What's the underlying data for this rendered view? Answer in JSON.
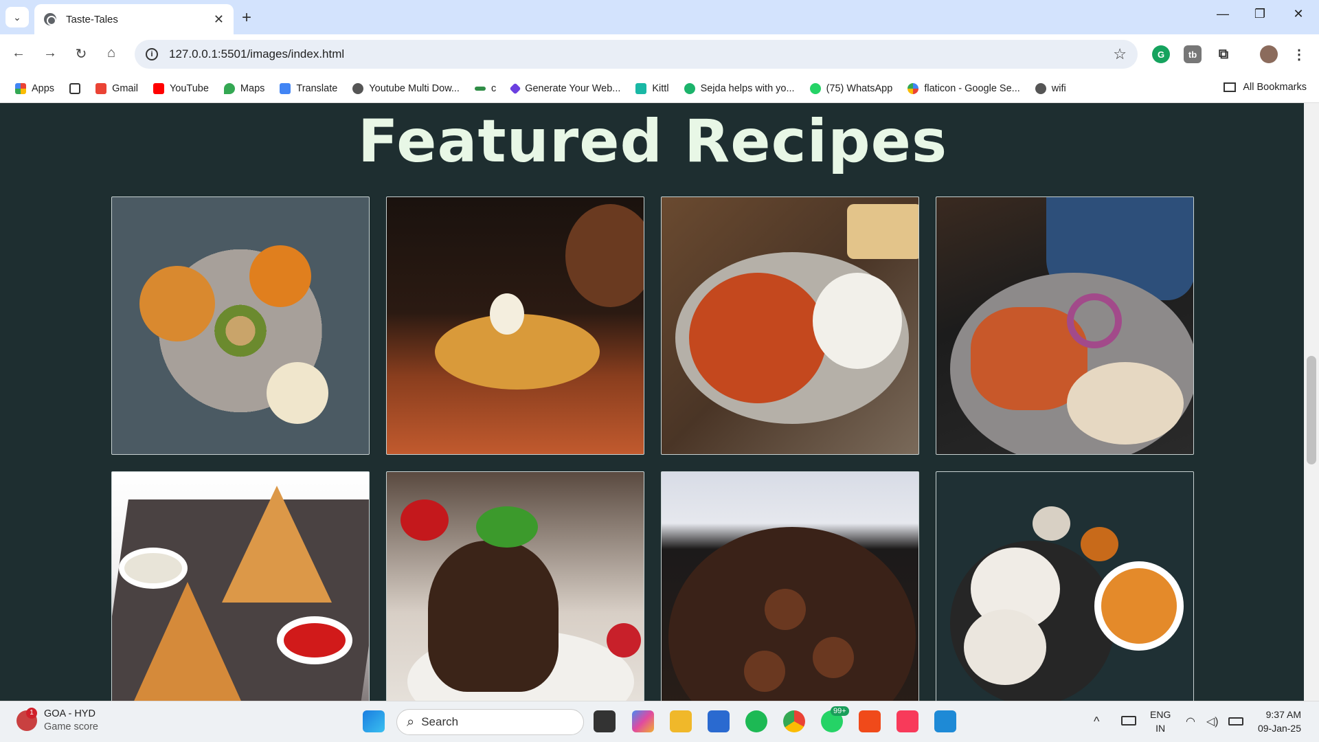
{
  "browser": {
    "tab_title": "Taste-Tales",
    "url": "127.0.0.1:5501/images/index.html",
    "bookmarks": [
      "Apps",
      "Gmail",
      "YouTube",
      "Maps",
      "Translate",
      "Youtube Multi Dow...",
      "c",
      "Generate Your Web...",
      "Kittl",
      "Sejda helps with yo...",
      "(75) WhatsApp",
      "flaticon - Google Se...",
      "wifi"
    ],
    "all_bookmarks": "All Bookmarks"
  },
  "page": {
    "heading": "Featured Recipes"
  },
  "taskbar": {
    "weather_title": "GOA - HYD",
    "weather_sub": "Game score",
    "weather_badge": "1",
    "search_label": "Search",
    "whatsapp_badge": "99+",
    "lang_top": "ENG",
    "lang_bottom": "IN",
    "time": "9:37 AM",
    "date": "09-Jan-25"
  }
}
